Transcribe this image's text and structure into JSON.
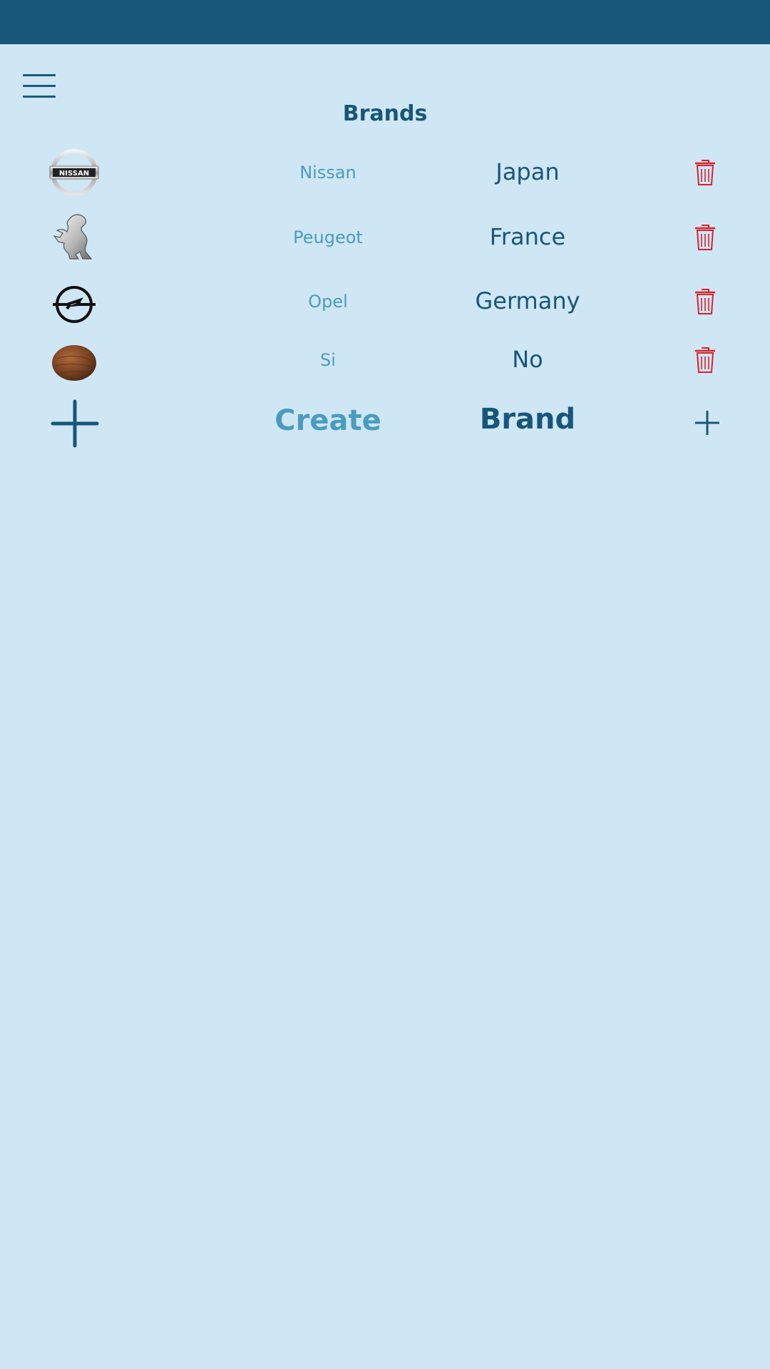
{
  "header": {
    "title": "Brands",
    "menu_icon": "hamburger-menu-icon"
  },
  "brands": [
    {
      "name": "Nissan",
      "country": "Japan",
      "logo": "nissan-logo",
      "delete_icon": "trash-icon"
    },
    {
      "name": "Peugeot",
      "country": "France",
      "logo": "peugeot-logo",
      "delete_icon": "trash-icon"
    },
    {
      "name": "Opel",
      "country": "Germany",
      "logo": "opel-logo",
      "delete_icon": "trash-icon"
    },
    {
      "name": "Si",
      "country": "No",
      "logo": "coconut-image",
      "delete_icon": "trash-icon"
    }
  ],
  "create": {
    "label_left": "Create",
    "label_right": "Brand",
    "icon": "plus-icon"
  },
  "colors": {
    "status_bar": "#175679",
    "background": "#cfe6f4",
    "primary": "#175679",
    "accent": "#4a9cbf",
    "delete": "#d9222b"
  }
}
